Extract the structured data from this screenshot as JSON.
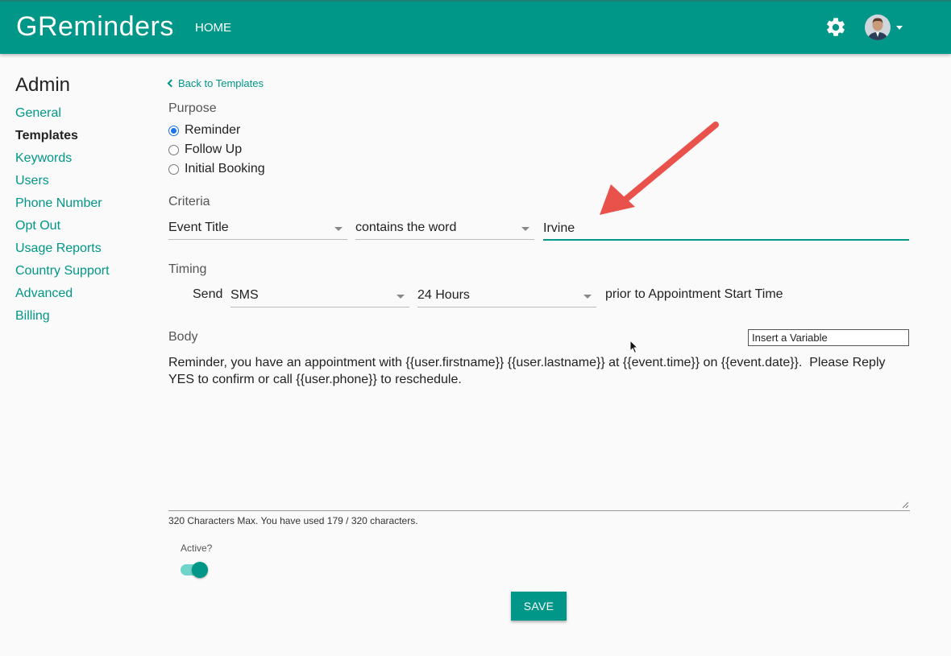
{
  "header": {
    "logo": "GReminders",
    "nav_home": "HOME",
    "settings_icon": "gear-icon",
    "avatar_icon": "user-avatar",
    "menu_caret_icon": "caret-down-icon",
    "brand_color": "#009688"
  },
  "sidebar": {
    "title": "Admin",
    "items": [
      {
        "label": "General",
        "active": false
      },
      {
        "label": "Templates",
        "active": true
      },
      {
        "label": "Keywords",
        "active": false
      },
      {
        "label": "Users",
        "active": false
      },
      {
        "label": "Phone Number",
        "active": false
      },
      {
        "label": "Opt Out",
        "active": false
      },
      {
        "label": "Usage Reports",
        "active": false
      },
      {
        "label": "Country Support",
        "active": false
      },
      {
        "label": "Advanced",
        "active": false
      },
      {
        "label": "Billing",
        "active": false
      }
    ]
  },
  "form": {
    "back_link": "Back to Templates",
    "purpose": {
      "label": "Purpose",
      "options": [
        {
          "label": "Reminder",
          "checked": true
        },
        {
          "label": "Follow Up",
          "checked": false
        },
        {
          "label": "Initial Booking",
          "checked": false
        }
      ]
    },
    "criteria": {
      "label": "Criteria",
      "field": "Event Title",
      "operator": "contains the word",
      "value": "Irvine"
    },
    "timing": {
      "label": "Timing",
      "send_label": "Send",
      "channel": "SMS",
      "offset": "24 Hours",
      "suffix": "prior to Appointment Start Time"
    },
    "body": {
      "label": "Body",
      "insert_variable": "Insert a Variable",
      "text": "Reminder, you have an appointment with {{user.firstname}} {{user.lastname}} at {{event.time}} on {{event.date}}.  Please Reply YES to confirm or call {{user.phone}} to reschedule.",
      "char_count": "320 Characters Max. You have used 179 / 320 characters."
    },
    "active": {
      "label": "Active?",
      "on": true
    },
    "save_label": "SAVE"
  },
  "annotation": {
    "arrow_color": "#e8524a"
  }
}
